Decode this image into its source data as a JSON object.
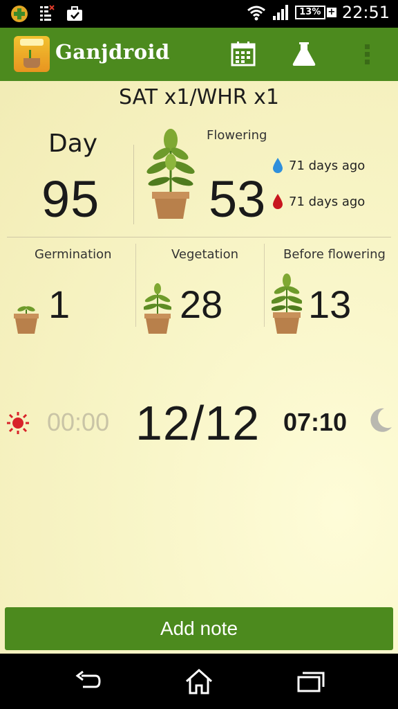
{
  "status_bar": {
    "time": "22:51",
    "battery": "13%",
    "icons": [
      "app-notification-icon",
      "sim-icon",
      "briefcase-icon",
      "wifi-icon",
      "signal-icon",
      "battery-icon"
    ]
  },
  "action_bar": {
    "title": "Ganjdroid",
    "actions": [
      "calendar-icon",
      "flask-icon",
      "overflow-menu-icon"
    ],
    "accent_color": "#4c8a1e"
  },
  "grow": {
    "strain": "SAT x1/WHR x1",
    "day_label": "Day",
    "day_value": "95",
    "flowering_label": "Flowering",
    "flowering_value": "53",
    "watered": "71 days ago",
    "fertilized": "71 days ago"
  },
  "phases": [
    {
      "label": "Germination",
      "value": "1"
    },
    {
      "label": "Vegetation",
      "value": "28"
    },
    {
      "label": "Before flowering",
      "value": "13"
    }
  ],
  "light": {
    "on_time": "00:00",
    "cycle": "12/12",
    "off_time": "07:10"
  },
  "add_note_label": "Add note"
}
